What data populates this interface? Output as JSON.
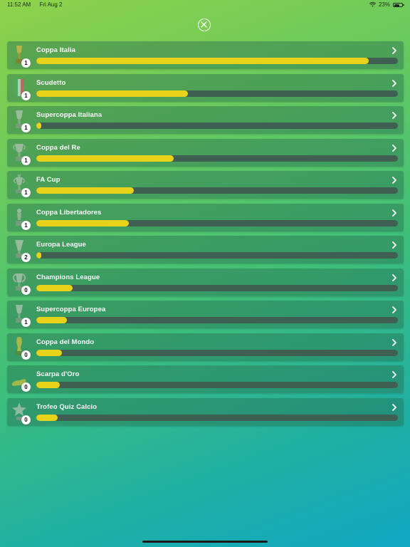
{
  "status_bar": {
    "time": "11:52 AM",
    "date": "Fri Aug 2",
    "battery": "23%"
  },
  "colors": {
    "progress_fill": "#e8d21a",
    "progress_track": "#3f5f52",
    "row_background": "rgba(40,110,80,0.45)"
  },
  "close_icon": "close-circle-icon",
  "trophies": [
    {
      "name": "Coppa Italia",
      "count": "1",
      "progress": 0.92,
      "icon": "coppa-italia-trophy-icon"
    },
    {
      "name": "Scudetto",
      "count": "1",
      "progress": 0.42,
      "icon": "scudetto-shield-icon"
    },
    {
      "name": "Supercoppa Italiana",
      "count": "1",
      "progress": 0.01,
      "icon": "supercoppa-italiana-trophy-icon"
    },
    {
      "name": "Coppa del Re",
      "count": "1",
      "progress": 0.38,
      "icon": "coppa-del-re-trophy-icon"
    },
    {
      "name": "FA Cup",
      "count": "1",
      "progress": 0.27,
      "icon": "fa-cup-trophy-icon"
    },
    {
      "name": "Coppa Libertadores",
      "count": "1",
      "progress": 0.255,
      "icon": "coppa-libertadores-trophy-icon"
    },
    {
      "name": "Europa League",
      "count": "2",
      "progress": 0.01,
      "icon": "europa-league-trophy-icon"
    },
    {
      "name": "Champions League",
      "count": "0",
      "progress": 0.1,
      "icon": "champions-league-trophy-icon"
    },
    {
      "name": "Supercoppa Europea",
      "count": "1",
      "progress": 0.085,
      "icon": "supercoppa-europea-trophy-icon"
    },
    {
      "name": "Coppa del Mondo",
      "count": "0",
      "progress": 0.07,
      "icon": "coppa-del-mondo-trophy-icon"
    },
    {
      "name": "Scarpa d'Oro",
      "count": "0",
      "progress": 0.065,
      "icon": "scarpa-d-oro-boot-icon"
    },
    {
      "name": "Trofeo Quiz Calcio",
      "count": "0",
      "progress": 0.06,
      "icon": "trofeo-quiz-calcio-star-icon"
    }
  ]
}
